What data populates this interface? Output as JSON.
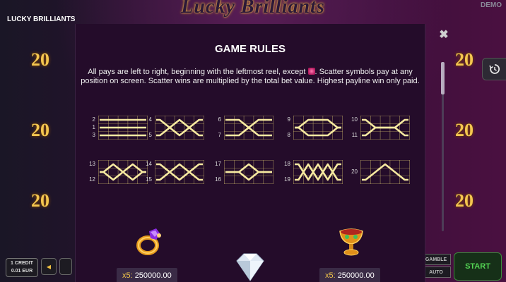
{
  "game": {
    "name": "LUCKY BRILLIANTS",
    "logo_text": "Lucky Brilliants",
    "mode": "DEMO"
  },
  "background": {
    "left_values": [
      "20",
      "20",
      "20"
    ],
    "right_values": [
      "20",
      "20",
      "20"
    ]
  },
  "controls": {
    "credit_line1": "1 CREDIT",
    "credit_line2": "0.01 EUR",
    "gamble_label": "GAMBLE",
    "auto_label": "AUTO",
    "start_label": "START"
  },
  "rules": {
    "title": "GAME RULES",
    "text_part1": "All pays are left to right, beginning with the leftmost reel, except",
    "text_part2": ". Scatter symbols pay at any position on screen. Scatter wins are multiplied by the total bet value. Highest payline win only paid."
  },
  "paylines": [
    {
      "labels_left": [
        "2",
        "1",
        "3"
      ],
      "labels_right": [],
      "pattern": "straight"
    },
    {
      "labels_left": [
        "4",
        "5"
      ],
      "labels_right": [],
      "pattern": "x"
    },
    {
      "labels_left": [
        "6",
        "7"
      ],
      "labels_right": [],
      "pattern": "cross-flat"
    },
    {
      "labels_left": [
        "9",
        "8"
      ],
      "labels_right": [],
      "pattern": "hexagon"
    },
    {
      "labels_left": [
        "10",
        "11"
      ],
      "labels_right": [],
      "pattern": "arch"
    },
    {
      "labels_left": [
        "13",
        "12"
      ],
      "labels_right": [],
      "pattern": "double-diamond"
    },
    {
      "labels_left": [
        "14",
        "15"
      ],
      "labels_right": [],
      "pattern": "double-x"
    },
    {
      "labels_left": [
        "17",
        "16"
      ],
      "labels_right": [],
      "pattern": "diamond-flat"
    },
    {
      "labels_left": [
        "18",
        "19"
      ],
      "labels_right": [],
      "pattern": "zigzag"
    },
    {
      "labels_left": [
        "20"
      ],
      "labels_right": [],
      "pattern": "wave"
    }
  ],
  "symbols": [
    {
      "icon": "ring-icon",
      "multiplier": "x5:",
      "value": "250000.00"
    },
    {
      "icon": "diamond-icon",
      "multiplier": "",
      "value": ""
    },
    {
      "icon": "chalice-icon",
      "multiplier": "x5:",
      "value": "250000.00"
    }
  ],
  "colors": {
    "payline": "#f6e9a0",
    "grid": "#c9b66a",
    "accent": "#f0c44a",
    "start": "#53d453"
  }
}
